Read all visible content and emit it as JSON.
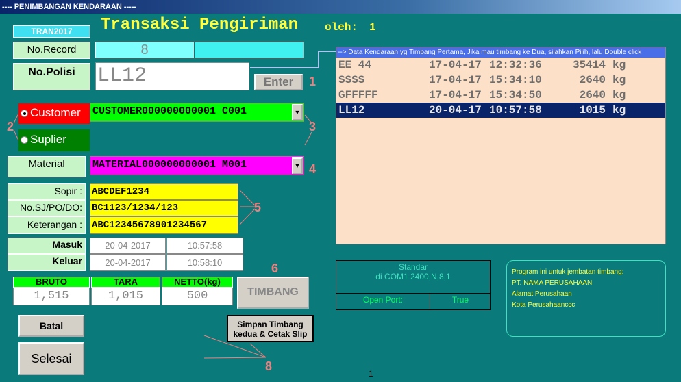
{
  "window": {
    "title": "---- PENIMBANGAN KENDARAAN -----"
  },
  "header": {
    "code": "TRAN2017",
    "title": "Transaksi Pengiriman",
    "by_label": "oleh:",
    "by_value": "1"
  },
  "record": {
    "label": "No.Record",
    "value": "8"
  },
  "polisi": {
    "label": "No.Polisi",
    "value": "LL12"
  },
  "enter_button": "Enter",
  "party": {
    "customer_label": "Customer",
    "supplier_label": "Suplier",
    "selected": "Customer",
    "value": "CUSTOMER000000000001  C001"
  },
  "material": {
    "label": "Material",
    "value": "MATERIAL000000000001  M001"
  },
  "fields": [
    {
      "label": "Sopir :",
      "value": "ABCDEF1234"
    },
    {
      "label": "No.SJ/PO/DO:",
      "value": "BC1123/1234/123"
    },
    {
      "label": "Keterangan :",
      "value": "ABC12345678901234567"
    }
  ],
  "times": [
    {
      "label": "Masuk",
      "date": "20-04-2017",
      "time": "10:57:58"
    },
    {
      "label": "Keluar",
      "date": "20-04-2017",
      "time": "10:58:10"
    }
  ],
  "weights": {
    "bruto_label": "BRUTO",
    "tara_label": "TARA",
    "netto_label": "NETTO(kg)",
    "bruto": "1,515",
    "tara": "1,015",
    "netto": "500"
  },
  "buttons": {
    "timbang": "TIMBANG",
    "simpan_line1": "Simpan Timbang",
    "simpan_line2": "kedua & Cetak Slip",
    "batal": "Batal",
    "selesai": "Selesai"
  },
  "vehicle_list": {
    "header": "--> Data Kendaraan yg Timbang Pertama, Jika mau timbang ke Dua, silahkan Pilih, lalu Double click",
    "rows": [
      {
        "plate": "EE 44",
        "date": "17-04-17",
        "time": "12:32:36",
        "weight": "35414",
        "unit": "kg",
        "selected": false
      },
      {
        "plate": "SSSS",
        "date": "17-04-17",
        "time": "15:34:10",
        "weight": "2640",
        "unit": "kg",
        "selected": false
      },
      {
        "plate": "GFFFFF",
        "date": "17-04-17",
        "time": "15:34:50",
        "weight": "2640",
        "unit": "kg",
        "selected": false
      },
      {
        "plate": "LL12",
        "date": "20-04-17",
        "time": "10:57:58",
        "weight": "1015",
        "unit": "kg",
        "selected": true
      }
    ]
  },
  "port": {
    "line1": "Standar",
    "line2": "di COM1 2400,N,8,1",
    "open_label": "Open Port:",
    "open_value": "True"
  },
  "info": {
    "line1": "Program ini untuk jembatan timbang:",
    "line2": "PT. NAMA PERUSAHAAN",
    "line3": "Alamat Perusahaan",
    "line4": "Kota Perusahaanccc"
  },
  "annotations": {
    "n1": "1",
    "n2": "2",
    "n3": "3",
    "n4": "4",
    "n5": "5",
    "n6": "6",
    "n8": "8"
  },
  "footer": {
    "page": "1"
  },
  "colors": {
    "background": "#0b7a7a",
    "customer_red": "#ff0000",
    "supplier_green": "#008000",
    "customer_field": "#00ff00",
    "material_field": "#ff00ff",
    "fields_yellow": "#ffff00",
    "title_yellow": "#ffff40",
    "annotation_pink": "#f08080"
  }
}
